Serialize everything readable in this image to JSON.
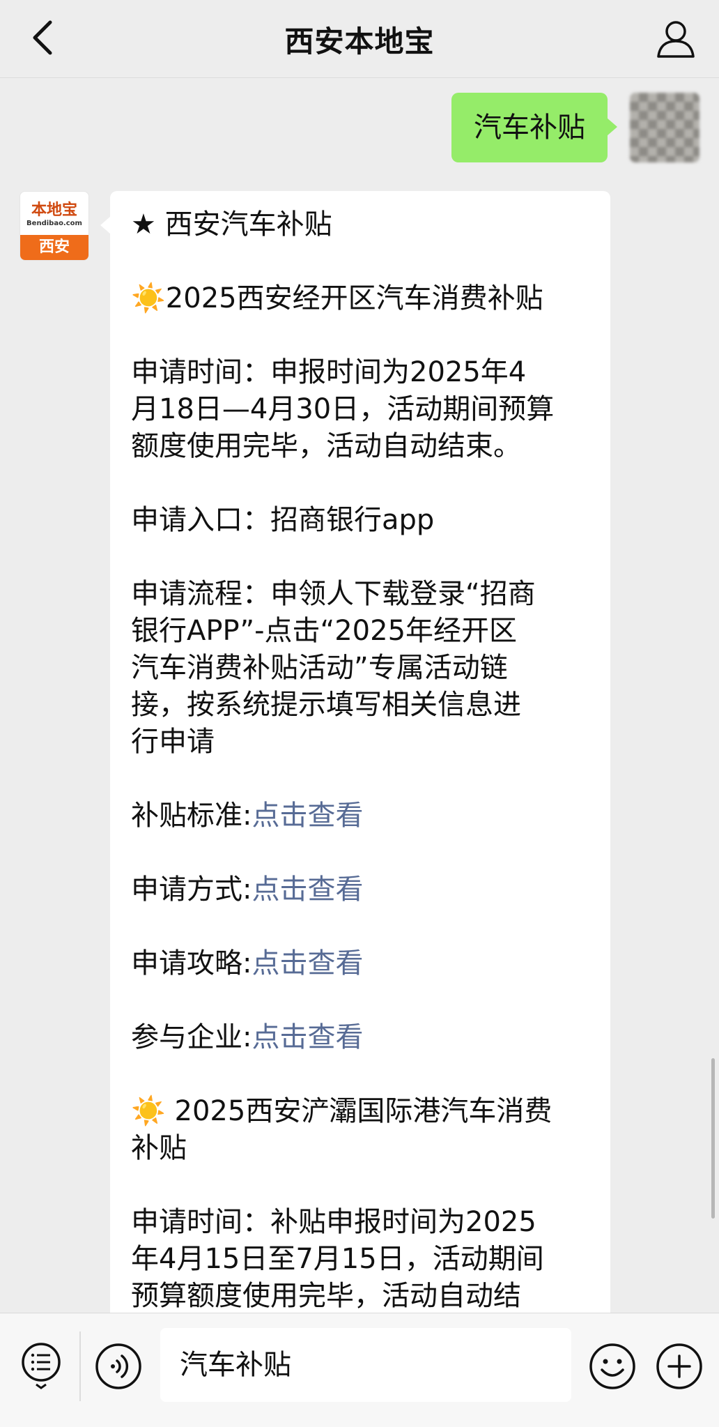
{
  "navbar": {
    "title": "西安本地宝"
  },
  "sent_message": {
    "text": "汽车补贴"
  },
  "bot_avatar": {
    "logo_main": "本地宝",
    "logo_sub": "Bendibao.com",
    "logo_city": "西安"
  },
  "message_lines": [
    "★ 西安汽车补贴",
    "",
    "☀️2025西安经开区汽车消费补贴",
    "",
    "申请时间：申报时间为2025年4",
    "月18日—4月30日，活动期间预算",
    "额度使用完毕，活动自动结束。",
    "",
    "申请入口：招商银行app",
    "",
    "申请流程：申领人下载登录“招商",
    "银行APP”-点击“2025年经开区",
    "汽车消费补贴活动”专属活动链",
    "接，按系统提示填写相关信息进",
    "行申请",
    "",
    "",
    "",
    "",
    "",
    "",
    "",
    "",
    "",
    "",
    "☀️ 2025西安浐灞国际港汽车消费",
    "补贴",
    "",
    "申请时间：补贴申报时间为2025",
    "年4月15日至7月15日，活动期间",
    "预算额度使用完毕，活动自动结"
  ],
  "link_rows": [
    {
      "label": "补贴标准:",
      "link": "点击查看"
    },
    {
      "label": "申请方式:",
      "link": "点击查看"
    },
    {
      "label": "申请攻略:",
      "link": "点击查看"
    },
    {
      "label": "参与企业:",
      "link": "点击查看"
    }
  ],
  "input_bar": {
    "input_value": "汽车补贴"
  },
  "colors": {
    "background": "#ededed",
    "sent_bubble": "#95ec69",
    "link": "#576b95",
    "logo_orange": "#ef6c1a"
  },
  "icons": {
    "back": "chevron-left-icon",
    "profile": "person-icon",
    "menu": "list-menu-icon",
    "voice": "voice-icon",
    "emoji": "smiley-icon",
    "plus": "plus-icon"
  }
}
